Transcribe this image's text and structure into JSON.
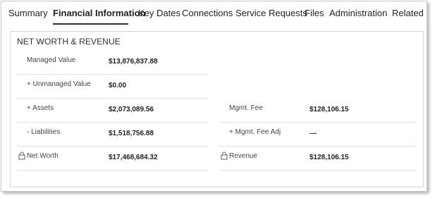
{
  "tabs": [
    {
      "label": "Summary"
    },
    {
      "label": "Financial Information"
    },
    {
      "label": "Key Dates"
    },
    {
      "label": "Connections"
    },
    {
      "label": "Service Requests"
    },
    {
      "label": "Files"
    },
    {
      "label": "Administration"
    },
    {
      "label": "Related"
    }
  ],
  "active_tab": "Financial Information",
  "section": {
    "title": "NET WORTH & REVENUE"
  },
  "fields": {
    "managed_value": {
      "label": "Managed Value",
      "value": "$13,876,837.88"
    },
    "unmanaged_value": {
      "label": "+ Unmanaged Value",
      "value": "$0.00"
    },
    "assets": {
      "label": "+ Assets",
      "value": "$2,073,089.56"
    },
    "liabilities": {
      "label": "- Liabilities",
      "value": "$1,518,756.88"
    },
    "net_worth": {
      "label": "Net Worth",
      "value": "$17,468,684.32"
    },
    "mgmt_fee": {
      "label": "Mgmt. Fee",
      "value": "$128,106.15"
    },
    "mgmt_fee_adj": {
      "label": "+ Mgmt. Fee Adj",
      "value": "---"
    },
    "revenue": {
      "label": "Revenue",
      "value": "$128,106.15"
    }
  },
  "icons": {
    "locked_field": "lock-icon"
  }
}
